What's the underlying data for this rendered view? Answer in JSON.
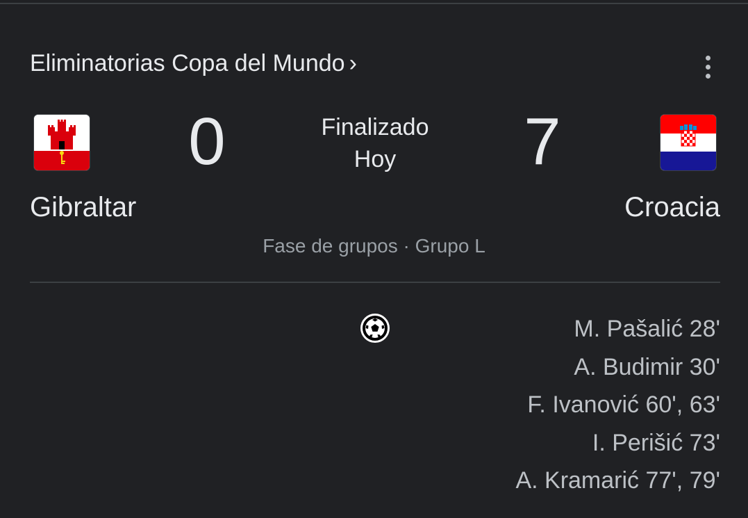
{
  "header": {
    "competition": "Eliminatorias Copa del Mundo",
    "chevron": "›",
    "more_icon": "more-vert-icon"
  },
  "match": {
    "home": {
      "name": "Gibraltar",
      "score": "0",
      "flag_icon": "gibraltar-flag-icon"
    },
    "away": {
      "name": "Croacia",
      "score": "7",
      "flag_icon": "croatia-flag-icon"
    },
    "status": "Finalizado",
    "date": "Hoy",
    "stage": "Fase de grupos · Grupo L"
  },
  "goals": {
    "icon": "soccer-ball-icon",
    "away_scorers": [
      "M. Pašalić 28'",
      "A. Budimir 30'",
      "F. Ivanović 60', 63'",
      "I. Perišić 73'",
      "A. Kramarić 77', 79'"
    ]
  },
  "colors": {
    "background": "#202124",
    "text_primary": "#e8eaed",
    "text_secondary": "#9aa0a6",
    "divider": "#3c4043"
  }
}
